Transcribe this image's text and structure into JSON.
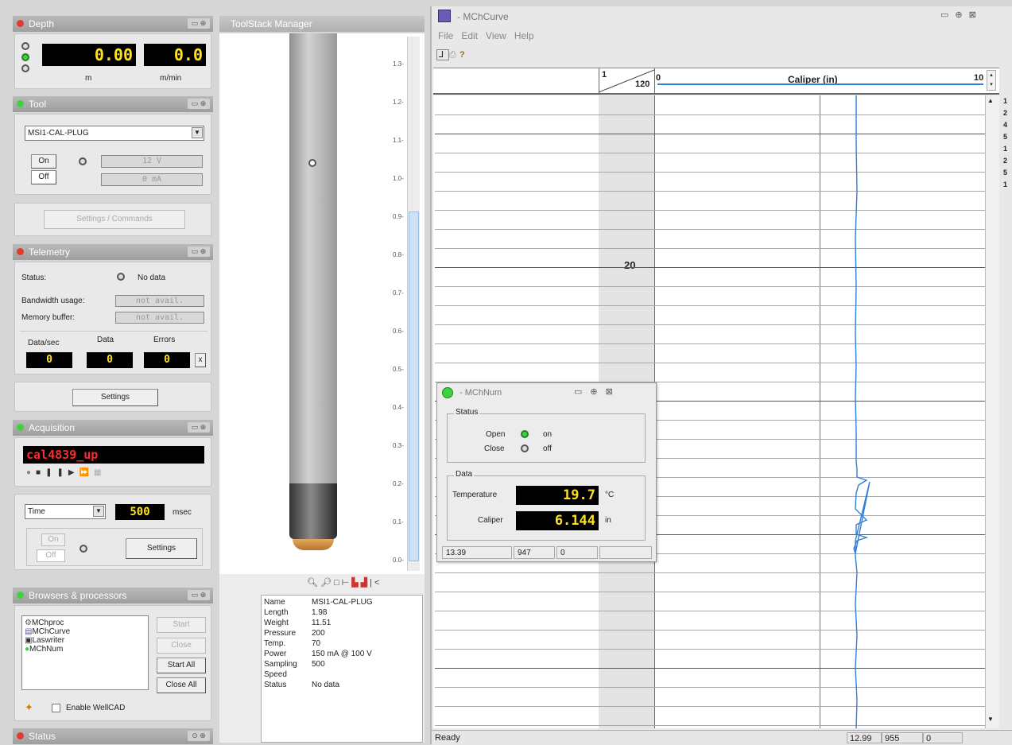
{
  "depth": {
    "title": "Depth",
    "value": "0.00",
    "speed": "0.0",
    "unit_depth": "m",
    "unit_speed": "m/min"
  },
  "tool": {
    "title": "Tool",
    "selected": "MSI1-CAL-PLUG",
    "on_label": "On",
    "off_label": "Off",
    "voltage": "12 V",
    "current": "0 mA",
    "settings_label": "Settings / Commands"
  },
  "telemetry": {
    "title": "Telemetry",
    "status_label": "Status:",
    "status_value": "No data",
    "bandwidth_label": "Bandwidth usage:",
    "bandwidth_value": "not avail.",
    "memory_label": "Memory buffer:",
    "memory_value": "not avail.",
    "datasec_label": "Data/sec",
    "data_label": "Data",
    "errors_label": "Errors",
    "datasec_value": "0",
    "data_value": "0",
    "errors_value": "0",
    "clear_label": "x",
    "settings_label": "Settings"
  },
  "acquisition": {
    "title": "Acquisition",
    "file": "cal4839_up",
    "mode": "Time",
    "interval": "500",
    "interval_unit": "msec",
    "on_label": "On",
    "off_label": "Off",
    "settings_label": "Settings"
  },
  "browsers": {
    "title": "Browsers & processors",
    "items": [
      "MChproc",
      "MChCurve",
      "Laswriter",
      "MChNum"
    ],
    "start": "Start",
    "close": "Close",
    "start_all": "Start All",
    "close_all": "Close All",
    "enable_wellcad": "Enable WellCAD"
  },
  "status_panel": {
    "title": "Status"
  },
  "toolstack": {
    "title": "ToolStack Manager",
    "ticks": [
      "1.3-",
      "1.2-",
      "1.1-",
      "1.0-",
      "0.9-",
      "0.8-",
      "0.7-",
      "0.6-",
      "0.5-",
      "0.4-",
      "0.3-",
      "0.2-",
      "0.1-",
      "0.0-"
    ],
    "props": [
      [
        "Name",
        "MSI1-CAL-PLUG"
      ],
      [
        "Length",
        "1.98"
      ],
      [
        "Weight",
        "11.51"
      ],
      [
        "Pressure",
        "200"
      ],
      [
        "Temp.",
        "70"
      ],
      [
        "Power",
        "150 mA @ 100 V"
      ],
      [
        "Sampling",
        "500"
      ],
      [
        "Speed",
        ""
      ],
      [
        "Status",
        "No data"
      ]
    ]
  },
  "curve": {
    "title": "- MChCurve",
    "menu": [
      "File",
      "Edit",
      "View",
      "Help"
    ],
    "scale_top": "1",
    "scale_bottom": "120",
    "track_min": "0",
    "track_title": "Caliper (in)",
    "track_max": "10",
    "depth_label": "20",
    "status": "Ready",
    "status_cells": [
      "12.99",
      "955",
      "0"
    ],
    "side_digits": [
      "1",
      "2",
      "4",
      "5",
      "1",
      "2",
      "5",
      "1"
    ],
    "accent": "#2f7fd6"
  },
  "num": {
    "title": "- MChNum",
    "status_group": "Status",
    "open_label": "Open",
    "open_value": "on",
    "close_label": "Close",
    "close_value": "off",
    "data_group": "Data",
    "temp_label": "Temperature",
    "temp_value": "19.7",
    "temp_unit": "°C",
    "cal_label": "Caliper",
    "cal_value": "6.144",
    "cal_unit": "in",
    "status_cells": [
      "13.39",
      "947",
      "0"
    ]
  }
}
